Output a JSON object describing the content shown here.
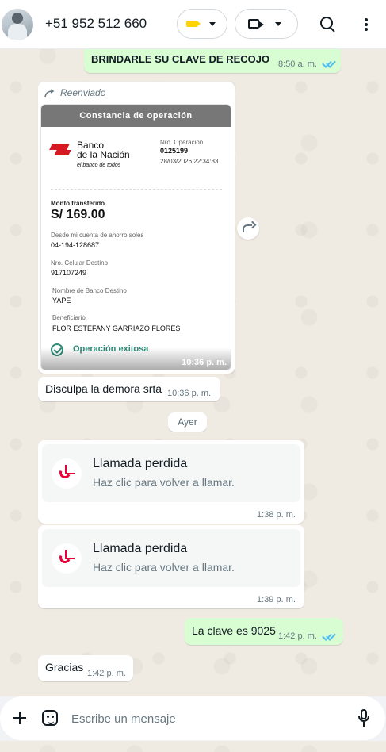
{
  "header": {
    "contact": "+51 952 512 660",
    "label_color": "#ffd400"
  },
  "messages": {
    "top_out_text": "BRINDARLE SU CLAVE DE RECOJO",
    "top_out_time": "8:50 a. m.",
    "forwarded_label": "Reenviado",
    "receipt": {
      "header": "Constancia de operación",
      "bank_name_line1": "Banco",
      "bank_name_line2": "de la Nación",
      "bank_slogan": "el banco de todos",
      "op_label": "Nro. Operación",
      "op_number": "0125199",
      "op_date": "28/03/2026 22:34:33",
      "amount_label": "Monto transferido",
      "amount": "S/ 169.00",
      "account_label": "Desde mi cuenta de ahorro soles",
      "account": "04-194-128687",
      "phone_label": "Nro. Celular Destino",
      "phone": "917107249",
      "bank_dest_label": "Nombre de Banco Destino",
      "bank_dest": "YAPE",
      "beneficiary_label": "Beneficiario",
      "beneficiary": "FLOR ESTEFANY GARRIAZO FLORES",
      "status": "Operación exitosa",
      "time": "10:36 p. m."
    },
    "delay_text": "Disculpa la demora srta",
    "delay_time": "10:36 p. m.",
    "date_chip": "Ayer",
    "missed_call_1": {
      "title": "Llamada perdida",
      "subtitle": "Haz clic para volver a llamar.",
      "time": "1:38 p. m."
    },
    "missed_call_2": {
      "title": "Llamada perdida",
      "subtitle": "Haz clic para volver a llamar.",
      "time": "1:39 p. m."
    },
    "key_text": "La clave es 9025",
    "key_time": "1:42 p. m.",
    "thanks_text": "Gracias",
    "thanks_time": "1:42 p. m."
  },
  "composer": {
    "placeholder": "Escribe un mensaje"
  }
}
